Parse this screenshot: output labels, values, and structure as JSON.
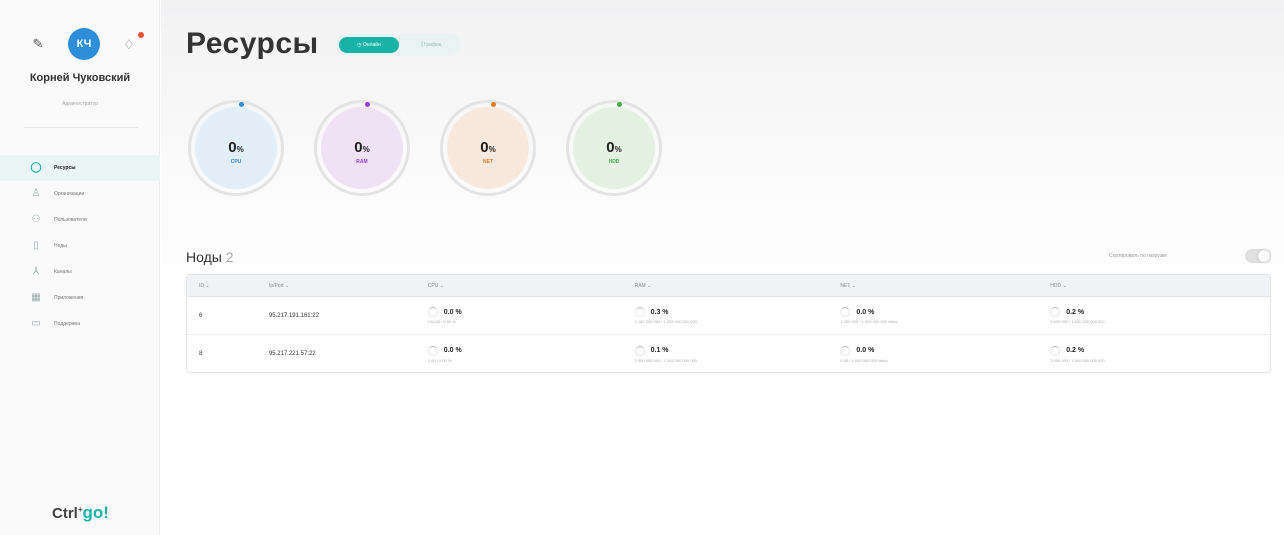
{
  "sidebar": {
    "avatar_initials": "КЧ",
    "user_name": "Корней Чуковский",
    "user_role": "Администратор",
    "nav": [
      {
        "label": "Ресурсы",
        "icon": "resources-icon",
        "active": true
      },
      {
        "label": "Организации",
        "icon": "organization-icon",
        "active": false
      },
      {
        "label": "Пользователи",
        "icon": "users-icon",
        "active": false
      },
      {
        "label": "Ноды",
        "icon": "node-icon",
        "active": false
      },
      {
        "label": "Каналы",
        "icon": "channels-icon",
        "active": false
      },
      {
        "label": "Приложения",
        "icon": "apps-icon",
        "active": false
      },
      {
        "label": "Поддержка",
        "icon": "support-icon",
        "active": false
      }
    ],
    "logo_text": "Ctrl",
    "logo_sup": "+",
    "logo_go": "go!"
  },
  "header": {
    "title": "Ресурсы",
    "btn_online": "Онлайн",
    "btn_graph": "График"
  },
  "gauges": [
    {
      "value": "0",
      "unit": "%",
      "label": "CPU",
      "color": "#2e8fd8",
      "bg": "#e2eef8"
    },
    {
      "value": "0",
      "unit": "%",
      "label": "RAM",
      "color": "#9b3fd0",
      "bg": "#efe2f5"
    },
    {
      "value": "0",
      "unit": "%",
      "label": "NET",
      "color": "#e07a24",
      "bg": "#f8e9de"
    },
    {
      "value": "0",
      "unit": "%",
      "label": "HDD",
      "color": "#3db043",
      "bg": "#e5f1e3"
    }
  ],
  "nodes": {
    "title": "Ноды",
    "count": "2",
    "sort_label": "Сортировать по нагрузке",
    "columns": [
      "ID",
      "Ip/Port",
      "CPU",
      "RAM",
      "NET",
      "HDD"
    ],
    "rows": [
      {
        "id": "6",
        "ip": "95.217.191.161:22",
        "cpu": {
          "value": "0.0",
          "unit": "%",
          "sub": "100.00 / 0.00 %"
        },
        "ram": {
          "value": "0.3",
          "unit": "%",
          "sub": "3 182 000 000 / 1 203 000 000 000"
        },
        "net": {
          "value": "0.0",
          "unit": "%",
          "sub": "1 000 000 / 1 000 000 000 bits/s"
        },
        "hdd": {
          "value": "0.2",
          "unit": "%",
          "sub": "3 000 000 / 1 000 000 000 000"
        }
      },
      {
        "id": "8",
        "ip": "95.217.221.57:22",
        "cpu": {
          "value": "0.0",
          "unit": "%",
          "sub": "0.00 / 0.00 %"
        },
        "ram": {
          "value": "0.1",
          "unit": "%",
          "sub": "2 000 000 000 / 1 203 000 000 000"
        },
        "net": {
          "value": "0.0",
          "unit": "%",
          "sub": "0.00 / 1 000 000 000 bits/s"
        },
        "hdd": {
          "value": "0.2",
          "unit": "%",
          "sub": "3 000 000 / 1 000 000 000 000"
        }
      }
    ]
  }
}
